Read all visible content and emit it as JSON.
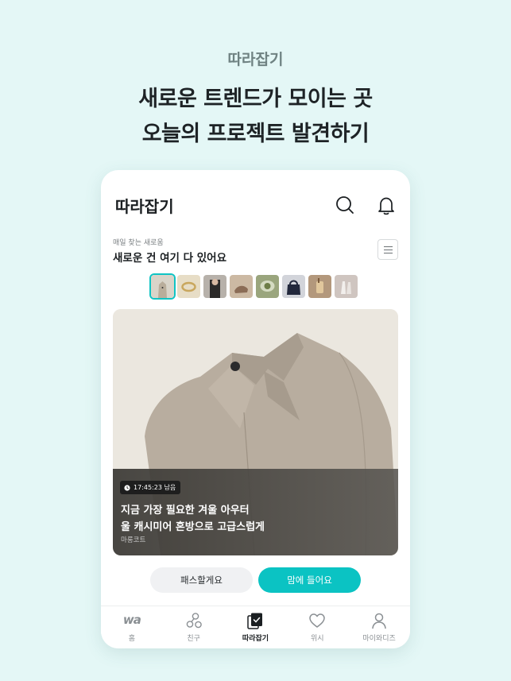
{
  "promo": {
    "kicker": "따라잡기",
    "headline_line1": "새로운 트렌드가 모이는 곳",
    "headline_line2": "오늘의 프로젝트 발견하기"
  },
  "app": {
    "title": "따라잡기",
    "header_icons": [
      "search-icon",
      "bell-icon"
    ],
    "section_kicker": "매일 찾는 새로움",
    "section_title": "새로운 건 여기 다 있어요",
    "thumbnails_count": 8,
    "selected_thumbnail": 1
  },
  "card": {
    "timer": "17:45:23 남음",
    "headline_line1": "지금 가장 필요한 겨울 아우터",
    "headline_line2": "울 캐시미어 혼방으로 고급스럽게",
    "brand": "마롱코트"
  },
  "actions": {
    "pass_label": "패스할게요",
    "like_label": "맘에 들어요"
  },
  "tabbar": {
    "items": [
      {
        "label": "홈",
        "icon": "wa-logo-icon"
      },
      {
        "label": "친구",
        "icon": "friends-icon"
      },
      {
        "label": "따라잡기",
        "icon": "catchup-icon"
      },
      {
        "label": "위시",
        "icon": "heart-icon"
      },
      {
        "label": "마이와디즈",
        "icon": "person-icon"
      }
    ],
    "logo_text": "wa",
    "active": "따라잡기"
  },
  "colors": {
    "background": "#e4f7f6",
    "accent": "#0bc3c3",
    "pass_button": "#f0f1f3"
  }
}
